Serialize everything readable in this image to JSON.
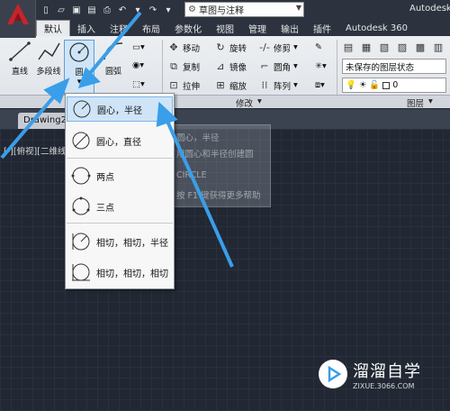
{
  "titlebar": {
    "workspace": "草图与注释",
    "app_title": "Autodesk"
  },
  "tabs": [
    "默认",
    "插入",
    "注释",
    "布局",
    "参数化",
    "视图",
    "管理",
    "输出",
    "插件",
    "Autodesk 360"
  ],
  "draw": {
    "line": "直线",
    "polyline": "多段线",
    "circle": "圆",
    "arc": "圆弧"
  },
  "modify": {
    "move": "移动",
    "rotate": "旋转",
    "trim": "修剪",
    "copy": "复制",
    "mirror": "镜像",
    "fillet": "圆角",
    "stretch": "拉伸",
    "scale": "缩放",
    "array": "阵列"
  },
  "layers": {
    "state": "未保存的图层状态",
    "current": "0"
  },
  "panels": {
    "modify": "修改",
    "layers": "图层"
  },
  "drawing_tab": "Drawing2",
  "viewport": "[-][俯视][二维线框]",
  "dropdown": {
    "items": [
      "圆心，半径",
      "圆心，直径",
      "两点",
      "三点",
      "相切，相切，半径",
      "相切，相切，相切"
    ]
  },
  "tooltip": {
    "title": "圆心，半径",
    "desc": "用圆心和半径创建圆",
    "command": "CIRCLE",
    "help": "按 F1 键获得更多帮助"
  },
  "watermark": {
    "name": "溜溜自学",
    "url": "ZIXUE.3066.COM"
  },
  "colors": {
    "accent_arrow": "#3a9ee8",
    "ribbon": "#e6e9ec",
    "canvas": "#212733",
    "selected": "#cfe5f7"
  }
}
